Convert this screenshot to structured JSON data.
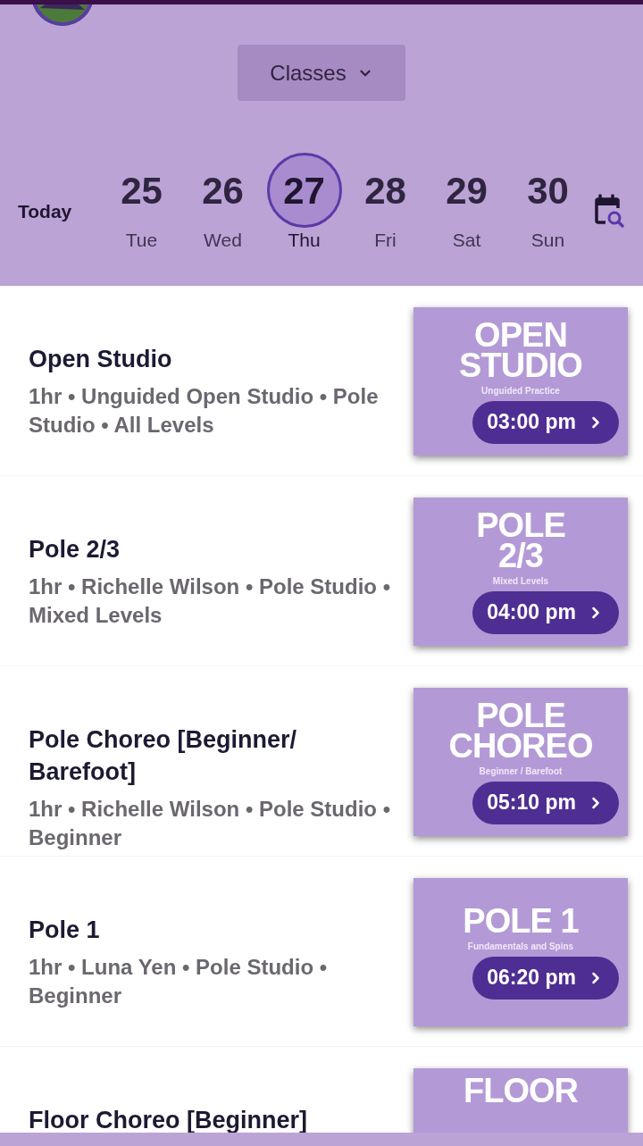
{
  "header": {
    "filter_button": "Classes",
    "today_label": "Today",
    "dates": [
      {
        "day": "25",
        "weekday": "Tue",
        "selected": false
      },
      {
        "day": "26",
        "weekday": "Wed",
        "selected": false
      },
      {
        "day": "27",
        "weekday": "Thu",
        "selected": true
      },
      {
        "day": "28",
        "weekday": "Fri",
        "selected": false
      },
      {
        "day": "29",
        "weekday": "Sat",
        "selected": false
      },
      {
        "day": "30",
        "weekday": "Sun",
        "selected": false
      }
    ]
  },
  "classes": [
    {
      "title": "Open Studio",
      "details": "1hr • Unguided Open Studio • Pole Studio • All Levels",
      "card_lines": [
        "OPEN",
        "STUDIO"
      ],
      "card_subtitle": "Unguided Practice",
      "time": "03:00 pm"
    },
    {
      "title": "Pole 2/3",
      "details": "1hr • Richelle Wilson • Pole Studio • Mixed Levels",
      "card_lines": [
        "POLE",
        "2/3"
      ],
      "card_subtitle": "Mixed Levels",
      "time": "04:00 pm"
    },
    {
      "title": "Pole Choreo [Beginner/ Barefoot]",
      "details": "1hr • Richelle Wilson • Pole Studio • Beginner",
      "card_lines": [
        "POLE",
        "CHOREO"
      ],
      "card_subtitle": "Beginner / Barefoot",
      "time": "05:10 pm"
    },
    {
      "title": "Pole 1",
      "details": "1hr • Luna Yen • Pole Studio • Beginner",
      "card_lines": [
        "POLE 1"
      ],
      "card_subtitle": "Fundamentals and Spins",
      "time": "06:20 pm"
    },
    {
      "title": "Floor Choreo [Beginner]",
      "card_lines": [
        "FLOOR"
      ]
    }
  ]
}
